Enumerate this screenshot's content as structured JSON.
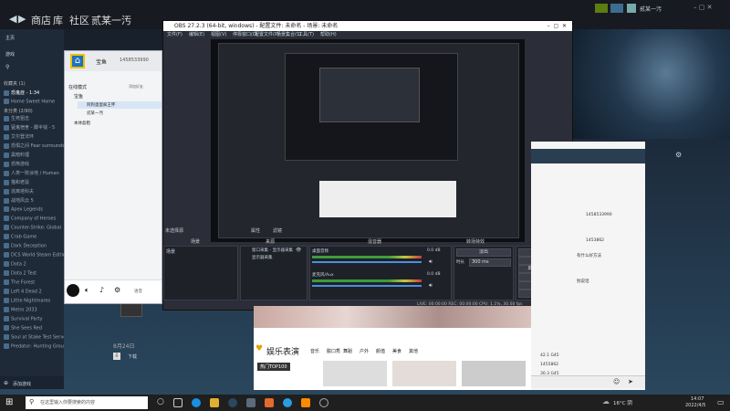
{
  "steam": {
    "nav": [
      "商店",
      "库",
      "社区",
      "贰某一汚"
    ],
    "user": "贰某一汚",
    "home_label": "主页",
    "games_label": "游戏",
    "sections": [
      "收藏夹 (1)",
      "未分类 (2/90)"
    ],
    "games": [
      "恐鬼症 - 1:34",
      "Home Sweet Home",
      "生死狙击",
      "猛鬼宿舍 - 脚半钱 - 5",
      "艾尔登法环",
      "恐惧之间 Fear surrounds",
      "黑暗料理",
      "恐怖游戏",
      "人类一败涂地 / Human",
      "猫和老鼠",
      "逃离塔科夫",
      "战地风云 5",
      "Apex Legends",
      "Company of Heroes",
      "Counter-Strike: Global",
      "Crab Game",
      "Dark Deception",
      "DCS World Steam Edition",
      "Dota 2",
      "Dota 2 Test",
      "The Forest",
      "Left 4 Dead 2",
      "Little Nightmares",
      "Metro 2033",
      "Survival Party",
      "She Sees Red",
      "Soul at Stake Test Server",
      "Predator: Hunting Grounds"
    ],
    "add_game": "添加游戏",
    "date": "8月24日",
    "downloads": "下载"
  },
  "friends": {
    "name": "宝鱼",
    "id": "1458533990",
    "status": "在线模式",
    "add_friend": "添加好友",
    "groups": [
      "宝鱼",
      "阿狗蛋蛋疯王怀",
      "贰某一汚",
      "本体盈粗"
    ],
    "voice_label": "语音"
  },
  "obs": {
    "title": "OBS 27.2.3 (64-bit, windows) - 配置文件: 未命名 - 场景: 未命名",
    "menu": [
      "文件(F)",
      "编辑(E)",
      "视图(V)",
      "停靠窗口(D)",
      "配置文件(P)",
      "场景集合(S)",
      "工具(T)",
      "帮助(H)"
    ],
    "no_source": "未选择源",
    "tabs": [
      "属性",
      "滤镜"
    ],
    "docks": [
      "场景",
      "来源",
      "混音器",
      "转场特效",
      "控件"
    ],
    "scene": "场景",
    "sources": [
      "窗口采集 - 显示器采集",
      "显示器采集"
    ],
    "mixer": [
      {
        "name": "桌面音频",
        "level": "0.0 dB"
      },
      {
        "name": "麦克风/Aux",
        "level": "0.0 dB"
      }
    ],
    "transition": {
      "type": "淡出",
      "duration_label": "时长",
      "duration": "300 ms"
    },
    "controls": [
      "开始推流",
      "开始录制",
      "启动虚拟摄像机",
      "工作室模式",
      "设置",
      "退出"
    ],
    "status": "LIVE: 00:00:00   REC: 00:00:00   CPU: 1.1%, 30.00 fps"
  },
  "browser": {
    "tabs": [
      "娱乐表演",
      "音乐",
      "脱口秀",
      "舞蹈",
      "户外",
      "颜值",
      "美食",
      "其他"
    ],
    "badge": "热门TOP100"
  },
  "chat": {
    "numbers": [
      "1458533990",
      "1453862",
      "42.1 G45",
      "1455862",
      "30.3 G45"
    ],
    "text": [
      "有什么好方法",
      "别说话"
    ]
  },
  "taskbar": {
    "search_placeholder": "在这里输入你要搜索的内容",
    "weather": "16°C 阴",
    "time": "14:07",
    "date": "2022/4/5"
  }
}
